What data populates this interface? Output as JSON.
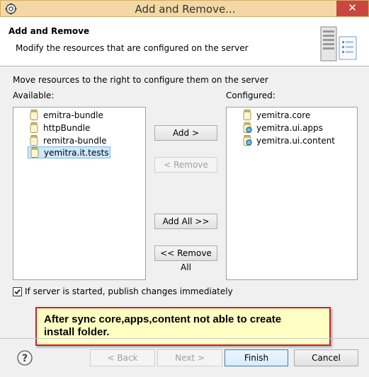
{
  "window": {
    "title": "Add and Remove...",
    "close_glyph": "✕",
    "app_icon": "gear-icon"
  },
  "header": {
    "title": "Add and Remove",
    "description": "Modify the resources that are configured on the server",
    "icon": "server-icon"
  },
  "main": {
    "instruction": "Move resources to the right to configure them on the server",
    "available_label": "Available:",
    "configured_label": "Configured:",
    "available": [
      {
        "label": "emitra-bundle",
        "icon": "jar-icon",
        "selected": false
      },
      {
        "label": "httpBundle",
        "icon": "jar-icon",
        "selected": false
      },
      {
        "label": "remitra-bundle",
        "icon": "jar-icon",
        "selected": false
      },
      {
        "label": "yemitra.it.tests",
        "icon": "jar-icon",
        "selected": true
      }
    ],
    "configured": [
      {
        "label": "yemitra.core",
        "icon": "jar-icon"
      },
      {
        "label": "yemitra.ui.apps",
        "icon": "jar-web-icon"
      },
      {
        "label": "yemitra.ui.content",
        "icon": "jar-web-icon"
      }
    ],
    "buttons": {
      "add": "Add >",
      "remove": "< Remove",
      "add_all": "Add All >>",
      "remove_all": "<< Remove All"
    },
    "publish_checkbox": {
      "label": "If server is started, publish changes immediately",
      "checked": true
    }
  },
  "annotation": {
    "line1": "After sync core,apps,content not able to create",
    "line2": "install folder."
  },
  "footer": {
    "help_icon": "help-icon",
    "back": "< Back",
    "next": "Next >",
    "finish": "Finish",
    "cancel": "Cancel"
  },
  "colors": {
    "titlebar": "#f3d8a6",
    "close_button": "#c9473f",
    "selection": "#cde8ff",
    "note_background": "#ffffc4",
    "note_border": "#c8212b"
  }
}
